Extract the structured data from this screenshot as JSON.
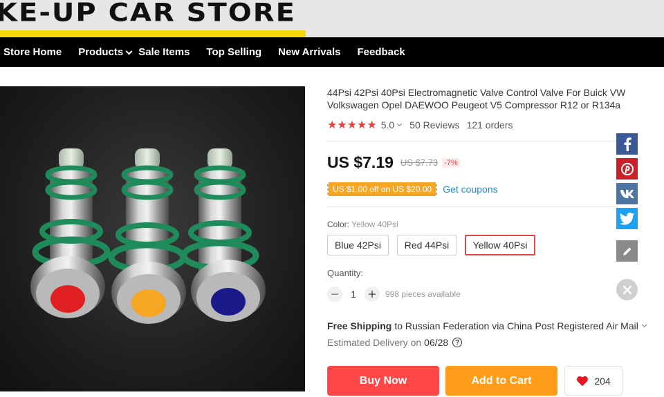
{
  "banner": {
    "title": "KE-UP CAR STORE"
  },
  "nav": {
    "items": [
      {
        "label": "Store Home"
      },
      {
        "label": "Products"
      },
      {
        "label": "Sale Items"
      },
      {
        "label": "Top Selling"
      },
      {
        "label": "New Arrivals"
      },
      {
        "label": "Feedback"
      }
    ]
  },
  "product": {
    "title": "44Psi 42Psi 40Psi Electromagnetic Valve Control Valve For Buick VW Volkswagen Opel DAEWOO Peugeot V5 Compressor R12 or R134a",
    "rating": "5.0",
    "stars": "★★★★★",
    "reviews": "50 Reviews",
    "orders": "121 orders",
    "price": "US $7.19",
    "old_price": "US $7.73",
    "discount": "-7%",
    "coupon": "US $1.00 off on US $20.00",
    "coupon_link": "Get coupons",
    "color_label": "Color:",
    "color_selected": "Yellow 40Psi",
    "options": [
      "Blue 42Psi",
      "Red 44Psi",
      "Yellow 40Psi"
    ],
    "quantity_label": "Quantity:",
    "quantity": "1",
    "available": "998 pieces available",
    "shipping_bold": "Free Shipping",
    "shipping_rest": "to Russian Federation via China Post Registered Air Mail",
    "delivery_label": "Estimated Delivery on",
    "delivery_date": "06/28",
    "buy_now": "Buy Now",
    "add_to_cart": "Add to Cart",
    "wishlist_count": "204"
  },
  "colors": {
    "nav_bg": "#000000",
    "banner_stripe": "#f5d90a",
    "star": "#f03b3b",
    "buy_now": "#ff4747",
    "add_to_cart": "#ff9c1a",
    "coupon": "#f5a623",
    "link": "#2d8ac9",
    "active_option": "#e04848"
  },
  "share": {
    "icons": [
      "facebook-icon",
      "pinterest-icon",
      "vk-icon",
      "twitter-icon",
      "edit-icon",
      "close-icon"
    ]
  }
}
